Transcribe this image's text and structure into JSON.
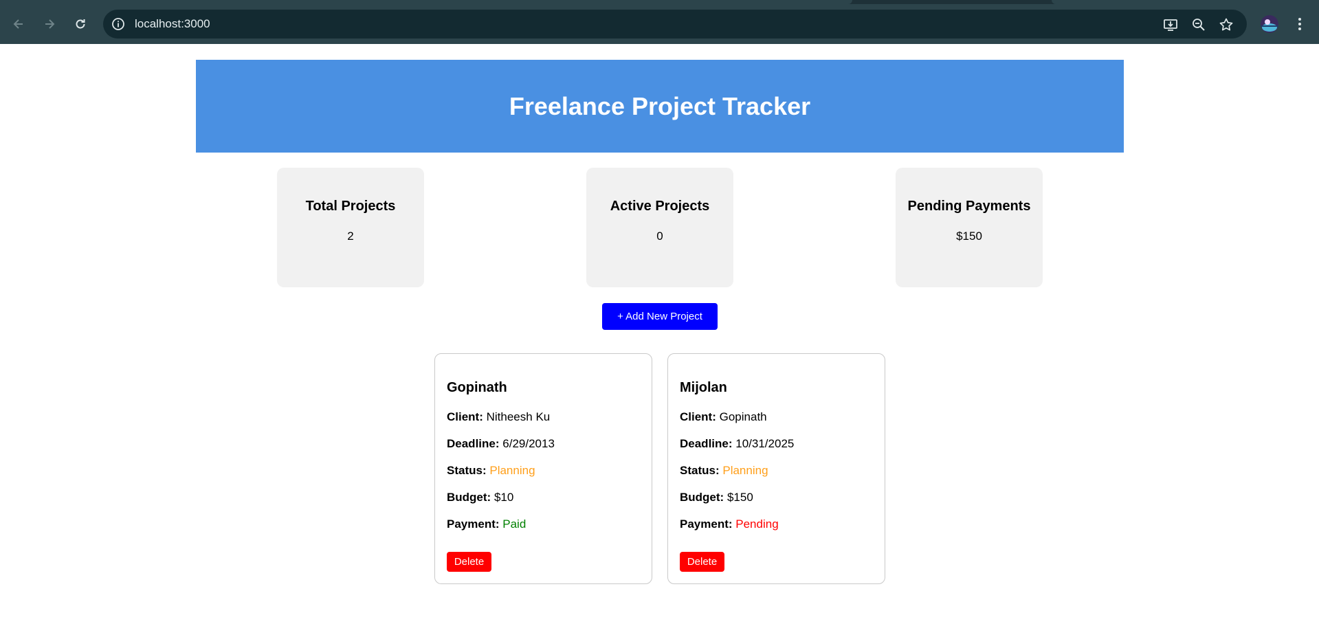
{
  "browser": {
    "url": "localhost:3000",
    "icons": [
      "back-arrow-icon",
      "forward-arrow-icon",
      "reload-icon",
      "site-info-icon",
      "install-app-icon",
      "zoom-icon",
      "bookmark-star-icon",
      "profile-avatar",
      "kebab-menu-icon"
    ],
    "colors": {
      "toolbar": "#2c444b",
      "omnibox": "#132a31"
    }
  },
  "app": {
    "title": "Freelance Project Tracker",
    "colors": {
      "header": "#4a90e2",
      "add_button": "#0000ff",
      "delete_button": "#ff0000",
      "planning": "#ff9f1a",
      "paid": "#008000",
      "pending": "#ff0000"
    }
  },
  "stats": [
    {
      "label": "Total Projects",
      "value": "2"
    },
    {
      "label": "Active Projects",
      "value": "0"
    },
    {
      "label": "Pending Payments",
      "value": "$150"
    }
  ],
  "add_button": {
    "label": "+ Add New Project"
  },
  "labels": {
    "client": "Client:",
    "deadline": "Deadline:",
    "status": "Status:",
    "budget": "Budget:",
    "payment": "Payment:",
    "delete": "Delete"
  },
  "projects": [
    {
      "name": "Gopinath",
      "client": "Nitheesh Ku",
      "deadline": "6/29/2013",
      "status": "Planning",
      "budget": "$10",
      "payment": "Paid"
    },
    {
      "name": "Mijolan",
      "client": "Gopinath",
      "deadline": "10/31/2025",
      "status": "Planning",
      "budget": "$150",
      "payment": "Pending"
    }
  ]
}
